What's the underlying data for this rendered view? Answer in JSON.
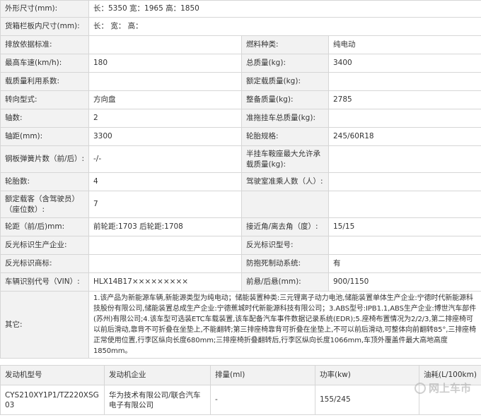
{
  "spec_rows": [
    {
      "type": "full",
      "label": "外形尺寸(mm):",
      "value": "长：5350 宽：1965 高：1850"
    },
    {
      "type": "full",
      "label": "货箱栏板内尺寸(mm):",
      "value": "长： 宽： 高："
    },
    {
      "type": "pair",
      "l1": "排放依据标准:",
      "v1": "",
      "l2": "燃料种类:",
      "v2": "纯电动"
    },
    {
      "type": "pair",
      "l1": "最高车速(km/h):",
      "v1": "180",
      "l2": "总质量(kg):",
      "v2": "3400"
    },
    {
      "type": "pair",
      "l1": "载质量利用系数:",
      "v1": "",
      "l2": "额定载质量(kg):",
      "v2": ""
    },
    {
      "type": "pair",
      "l1": "转向型式:",
      "v1": "方向盘",
      "l2": "整备质量(kg):",
      "v2": "2785"
    },
    {
      "type": "pair",
      "l1": "轴数:",
      "v1": "2",
      "l2": "准拖挂车总质量(kg):",
      "v2": ""
    },
    {
      "type": "pair",
      "l1": "轴距(mm):",
      "v1": "3300",
      "l2": "轮胎规格:",
      "v2": "245/60R18"
    },
    {
      "type": "pair",
      "l1": "钢板弹簧片数（前/后）:",
      "v1": "-/-",
      "l2": "半挂车鞍座最大允许承载质量(kg):",
      "v2": ""
    },
    {
      "type": "pair",
      "l1": "轮胎数:",
      "v1": "4",
      "l2": "驾驶室准乘人数（人）:",
      "v2": ""
    },
    {
      "type": "pair",
      "l1": "额定载客（含驾驶员）（座位数）:",
      "v1": "7",
      "l2": "",
      "v2": ""
    },
    {
      "type": "pair",
      "l1": "轮距（前/后)mm:",
      "v1": "前轮距:1703 后轮距:1708",
      "l2": "接近角/离去角（度）:",
      "v2": "15/15"
    },
    {
      "type": "pair",
      "l1": "反光标识生产企业:",
      "v1": "",
      "l2": "反光标识型号:",
      "v2": ""
    },
    {
      "type": "pair",
      "l1": "反光标识商标:",
      "v1": "",
      "l2": "防抱死制动系统:",
      "v2": "有"
    },
    {
      "type": "pair",
      "l1": "车辆识别代号（VIN）:",
      "v1": "HLX14B17×××××××××",
      "l2": "前悬/后悬(mm):",
      "v2": "900/1150"
    }
  ],
  "remark": {
    "label": "其它:",
    "value": "1.该产品为新能源车辆,新能源类型为纯电动；储能装置种类:三元锂离子动力电池,储能装置单体生产企业:宁德时代新能源科技股份有限公司,储能装置总成生产企业:宁德蕉城时代新能源科技有限公司；3.ABS型号:IPB1.1,ABS生产企业:博世汽车部件(苏州)有限公司;4.该车型可选装ETC车载装置,该车配备汽车事件数据记录系统(EDR);5.座椅布置情况为2/2/3,第二排座椅可以前后滑动,靠背不可折叠在坐垫上,不能翻转;第三排座椅靠背可折叠在坐垫上,不可以前后滑动,可整体向前翻转85°,三排座椅正常使用位置,行李区纵向长度680mm;三排座椅折叠翻转后,行李区纵向长度1066mm,车顶外覆盖件最大高地高度1850mm。"
  },
  "engine": {
    "headers": [
      "发动机型号",
      "发动机企业",
      "排量(ml)",
      "功率(kw)",
      "油耗(L/100km)"
    ],
    "rows": [
      [
        "CYS210XY1P1/TZ220XSG03",
        "华为技术有限公司/联合汽车电子有限公司",
        "-",
        "155/245",
        ""
      ]
    ]
  },
  "watermark": "网上车市"
}
